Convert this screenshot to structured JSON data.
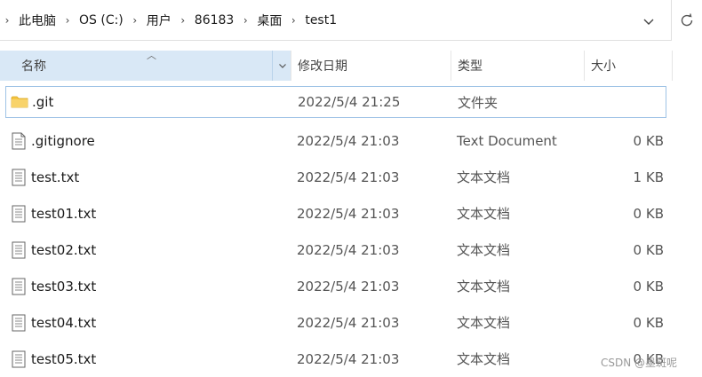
{
  "breadcrumb": [
    "此电脑",
    "OS (C:)",
    "用户",
    "86183",
    "桌面",
    "test1"
  ],
  "columns": {
    "name": "名称",
    "date": "修改日期",
    "type": "类型",
    "size": "大小"
  },
  "files": [
    {
      "name": ".git",
      "date": "2022/5/4 21:25",
      "type": "文件夹",
      "size": "",
      "icon": "folder-icon"
    },
    {
      "name": ".gitignore",
      "date": "2022/5/4 21:03",
      "type": "Text Document",
      "size": "0 KB",
      "icon": "document-icon"
    },
    {
      "name": "test.txt",
      "date": "2022/5/4 21:03",
      "type": "文本文档",
      "size": "1 KB",
      "icon": "text-file-icon"
    },
    {
      "name": "test01.txt",
      "date": "2022/5/4 21:03",
      "type": "文本文档",
      "size": "0 KB",
      "icon": "text-file-icon"
    },
    {
      "name": "test02.txt",
      "date": "2022/5/4 21:03",
      "type": "文本文档",
      "size": "0 KB",
      "icon": "text-file-icon"
    },
    {
      "name": "test03.txt",
      "date": "2022/5/4 21:03",
      "type": "文本文档",
      "size": "0 KB",
      "icon": "text-file-icon"
    },
    {
      "name": "test04.txt",
      "date": "2022/5/4 21:03",
      "type": "文本文档",
      "size": "0 KB",
      "icon": "text-file-icon"
    },
    {
      "name": "test05.txt",
      "date": "2022/5/4 21:03",
      "type": "文本文档",
      "size": "0 KB",
      "icon": "text-file-icon"
    }
  ],
  "watermark": "CSDN @墨斑呢",
  "colors": {
    "header_selected": "#d9e8f6",
    "row_selected_border": "#9fc3e6",
    "folder": "#f5c542"
  }
}
